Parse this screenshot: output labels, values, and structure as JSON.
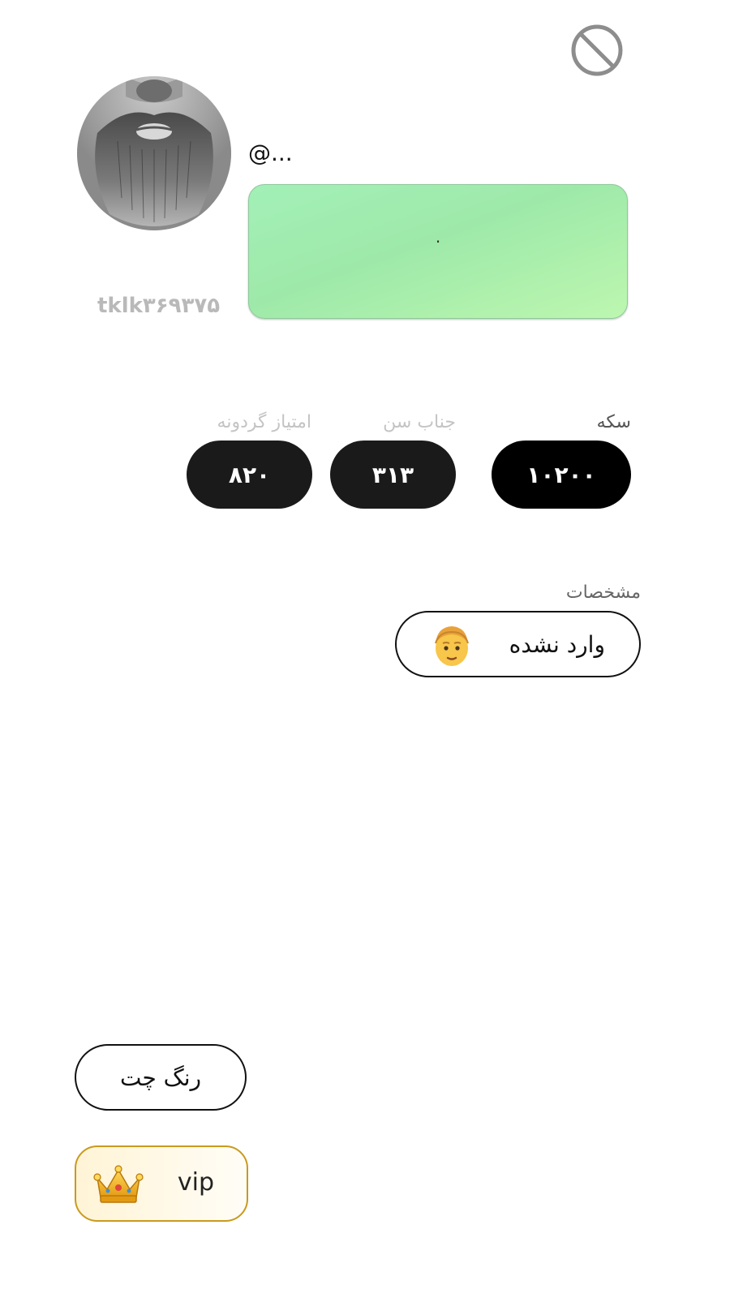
{
  "profile": {
    "handle": "@...",
    "bio": ".",
    "user_id": "tklk۳۶۹۳۷۵",
    "bio_card_color": "#a3f0b8"
  },
  "stats": {
    "coins": {
      "label": "سکه",
      "value": "۱۰۲۰۰"
    },
    "age": {
      "label": "جناب سن",
      "value": "۳۱۳"
    },
    "wheel_points": {
      "label": "امتیاز گردونه",
      "value": "۸۲۰"
    }
  },
  "details": {
    "section_label": "مشخصات",
    "gender_value": "وارد نشده",
    "gender_icon": "man-emoji-icon"
  },
  "actions": {
    "chat_color_label": "رنگ چت",
    "vip_label": "vip",
    "vip_icon": "crown-icon",
    "vip_accent": "#c99a1e"
  },
  "icons": {
    "block": "block-icon",
    "avatar": "bearded-avatar"
  }
}
